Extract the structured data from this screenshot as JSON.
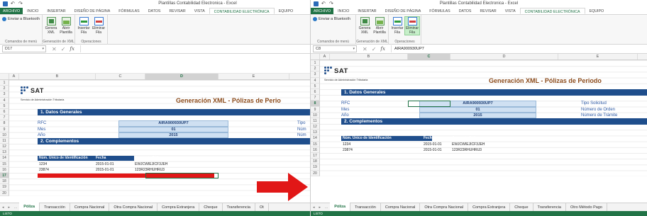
{
  "left": {
    "window_title": "Plantillas Contabilidad Electronica - Excel",
    "ribbon_tabs": [
      "ARCHIVO",
      "INICIO",
      "INSERTAR",
      "DISEÑO DE PÁGINA",
      "FÓRMULAS",
      "DATOS",
      "REVISAR",
      "VISTA",
      "CONTABILIDAD ELECTRÓNICA",
      "EQUIPO"
    ],
    "active_tab": "CONTABILIDAD ELECTRÓNICA",
    "ribbon": {
      "bluetooth": "Enviar a Bluetooth",
      "group_menu": "Comandos de menú",
      "genera": "Genera XML",
      "abrir": "Abrir Plantilla",
      "group_xml": "Generación de XML",
      "insertar": "Insertar Fila",
      "eliminar": "Eliminar Fila",
      "group_ops": "Operaciones"
    },
    "name_box": "D17",
    "formula": "",
    "columns": [
      "A",
      "B",
      "C",
      "D",
      "E"
    ],
    "selected_column": "D",
    "rows": [
      "1",
      "2",
      "3",
      "4",
      "5",
      "6",
      "7",
      "8",
      "9",
      "10",
      "11",
      "12",
      "13",
      "14",
      "15",
      "16",
      "17",
      "18",
      "19",
      "20"
    ],
    "selected_row": "17",
    "sat": {
      "word": "SAT",
      "sub": "Servicio de Administración Tributaria"
    },
    "title": "Generación XML - Pólizas de Perio",
    "sec1": "1. Datos Generales",
    "rfc_label": "RFC",
    "rfc_value": "AIRA900930UP7",
    "mes_label": "Mes",
    "mes_value": "01",
    "anio_label": "Año",
    "anio_value": "2015",
    "tipo": "Tipo",
    "num1": "Núm",
    "num2": "Núm",
    "sec2": "2. Complementos",
    "table_headers": [
      "Núm. Único de Identificación",
      "Fecha",
      "Concepto Póliza"
    ],
    "table_rows": [
      [
        "1234",
        "2015-01-01",
        "EWJCWIEJICF3JEH"
      ],
      [
        "23874",
        "2015-01-01",
        "123R23RHUHRU3"
      ]
    ],
    "sheet_nav": [
      "◂",
      "▸",
      "..."
    ],
    "sheet_tabs": [
      "Póliza",
      "Transacción",
      "Compra Nacional",
      "Otra Compra Nacional",
      "Compra Extranjera",
      "Cheque",
      "Transferencia",
      "Ot"
    ],
    "active_sheet": "Póliza",
    "status": "LISTO"
  },
  "right": {
    "window_title": "Plantillas Contabilidad Electronica - Excel",
    "ribbon_tabs": [
      "ARCHIVO",
      "INICIO",
      "INSERTAR",
      "DISEÑO DE PÁGINA",
      "FÓRMULAS",
      "DATOS",
      "REVISAR",
      "VISTA",
      "CONTABILIDAD ELECTRÓNICA",
      "EQUIPO"
    ],
    "active_tab": "CONTABILIDAD ELECTRÓNICA",
    "ribbon": {
      "bluetooth": "Enviar a Bluetooth",
      "group_menu": "Comandos de menú",
      "genera": "Genera XML",
      "abrir": "Abrir Plantilla",
      "group_xml": "Generación de XML",
      "insertar": "Insertar Fila",
      "eliminar": "Eliminar Fila",
      "group_ops": "Operaciones"
    },
    "name_box": "C8",
    "formula": "AIRA900930UP7",
    "columns": [
      "A",
      "B",
      "C",
      "D",
      "E",
      "F"
    ],
    "selected_column": "C",
    "rows": [
      "1",
      "2",
      "3",
      "4",
      "5",
      "6",
      "7",
      "8",
      "9",
      "10",
      "11",
      "12",
      "13",
      "14",
      "15",
      "16",
      "17",
      "18",
      "19",
      "20"
    ],
    "selected_row": "8",
    "sat": {
      "word": "SAT",
      "sub": "Servicio de Administración Tributaria"
    },
    "title": "Generación XML - Pólizas de Periodo",
    "sec1": "1. Datos Generales",
    "rfc_label": "RFC",
    "rfc_value": "AIRA900930UP7",
    "mes_label": "Mes",
    "mes_value": "01",
    "anio_label": "Año",
    "anio_value": "2015",
    "tipo": "Tipo Solicitud",
    "num1": "Número de Orden",
    "num2": "Número de Trámite",
    "sec2": "2. Complementos",
    "table_headers": [
      "Núm. Único de Identificación",
      "Fecha",
      "Concepto Póliza"
    ],
    "table_rows": [
      [
        "1234",
        "2015-01-01",
        "EWJCWIEJICF3JEH"
      ],
      [
        "23874",
        "2015-01-01",
        "123R23RHUHRU3"
      ]
    ],
    "sheet_nav": [
      "◂",
      "▸",
      "..."
    ],
    "sheet_tabs": [
      "Póliza",
      "Transacción",
      "Compra Nacional",
      "Otra Compra Nacional",
      "Compra Extranjera",
      "Cheque",
      "Transferencia",
      "Otro Método Pago"
    ],
    "active_sheet": "Póliza",
    "status": "LISTO"
  },
  "colors": {
    "excel_green": "#217346",
    "sat_blue": "#1f4e8c",
    "title_brown": "#8b4a1a",
    "arrow_red": "#e11717"
  }
}
